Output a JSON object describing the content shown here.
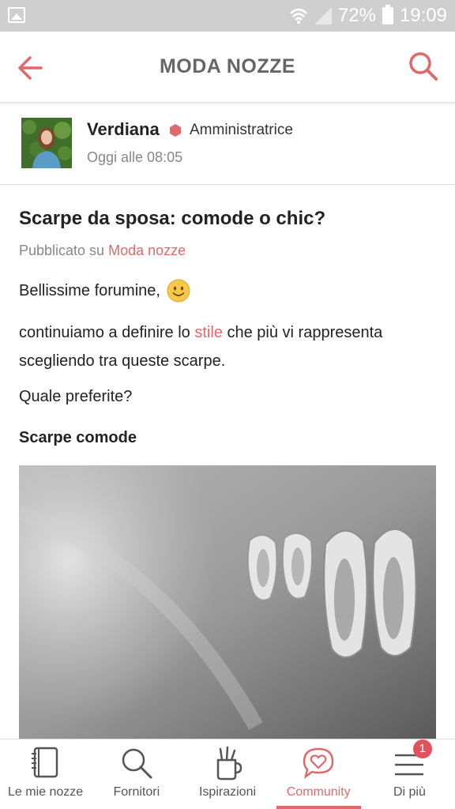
{
  "status_bar": {
    "battery": "72%",
    "time": "19:09"
  },
  "header": {
    "title": "MODA NOZZE"
  },
  "author": {
    "name": "Verdiana",
    "role": "Amministratrice",
    "time": "Oggi alle 08:05"
  },
  "post": {
    "title": "Scarpe da sposa: comode o chic?",
    "published_prefix": "Pubblicato su",
    "category": "Moda nozze",
    "greeting": "Bellissime forumine,",
    "body_before": "continuiamo a definire lo",
    "body_keyword": "stile",
    "body_after": "che più vi rappresenta scegliendo tra queste scarpe.",
    "question": "Quale preferite?",
    "section_heading": "Scarpe comode"
  },
  "bottom_nav": {
    "items": [
      {
        "label": "Le mie nozze",
        "icon": "notebook-icon"
      },
      {
        "label": "Fornitori",
        "icon": "search-icon"
      },
      {
        "label": "Ispirazioni",
        "icon": "pencil-cup-icon"
      },
      {
        "label": "Community",
        "icon": "heart-chat-icon",
        "active": true
      },
      {
        "label": "Di più",
        "icon": "menu-icon",
        "badge": "1"
      }
    ]
  },
  "colors": {
    "accent": "#e0696b",
    "status_bar": "#cfcfcf",
    "title_gray": "#666666"
  }
}
